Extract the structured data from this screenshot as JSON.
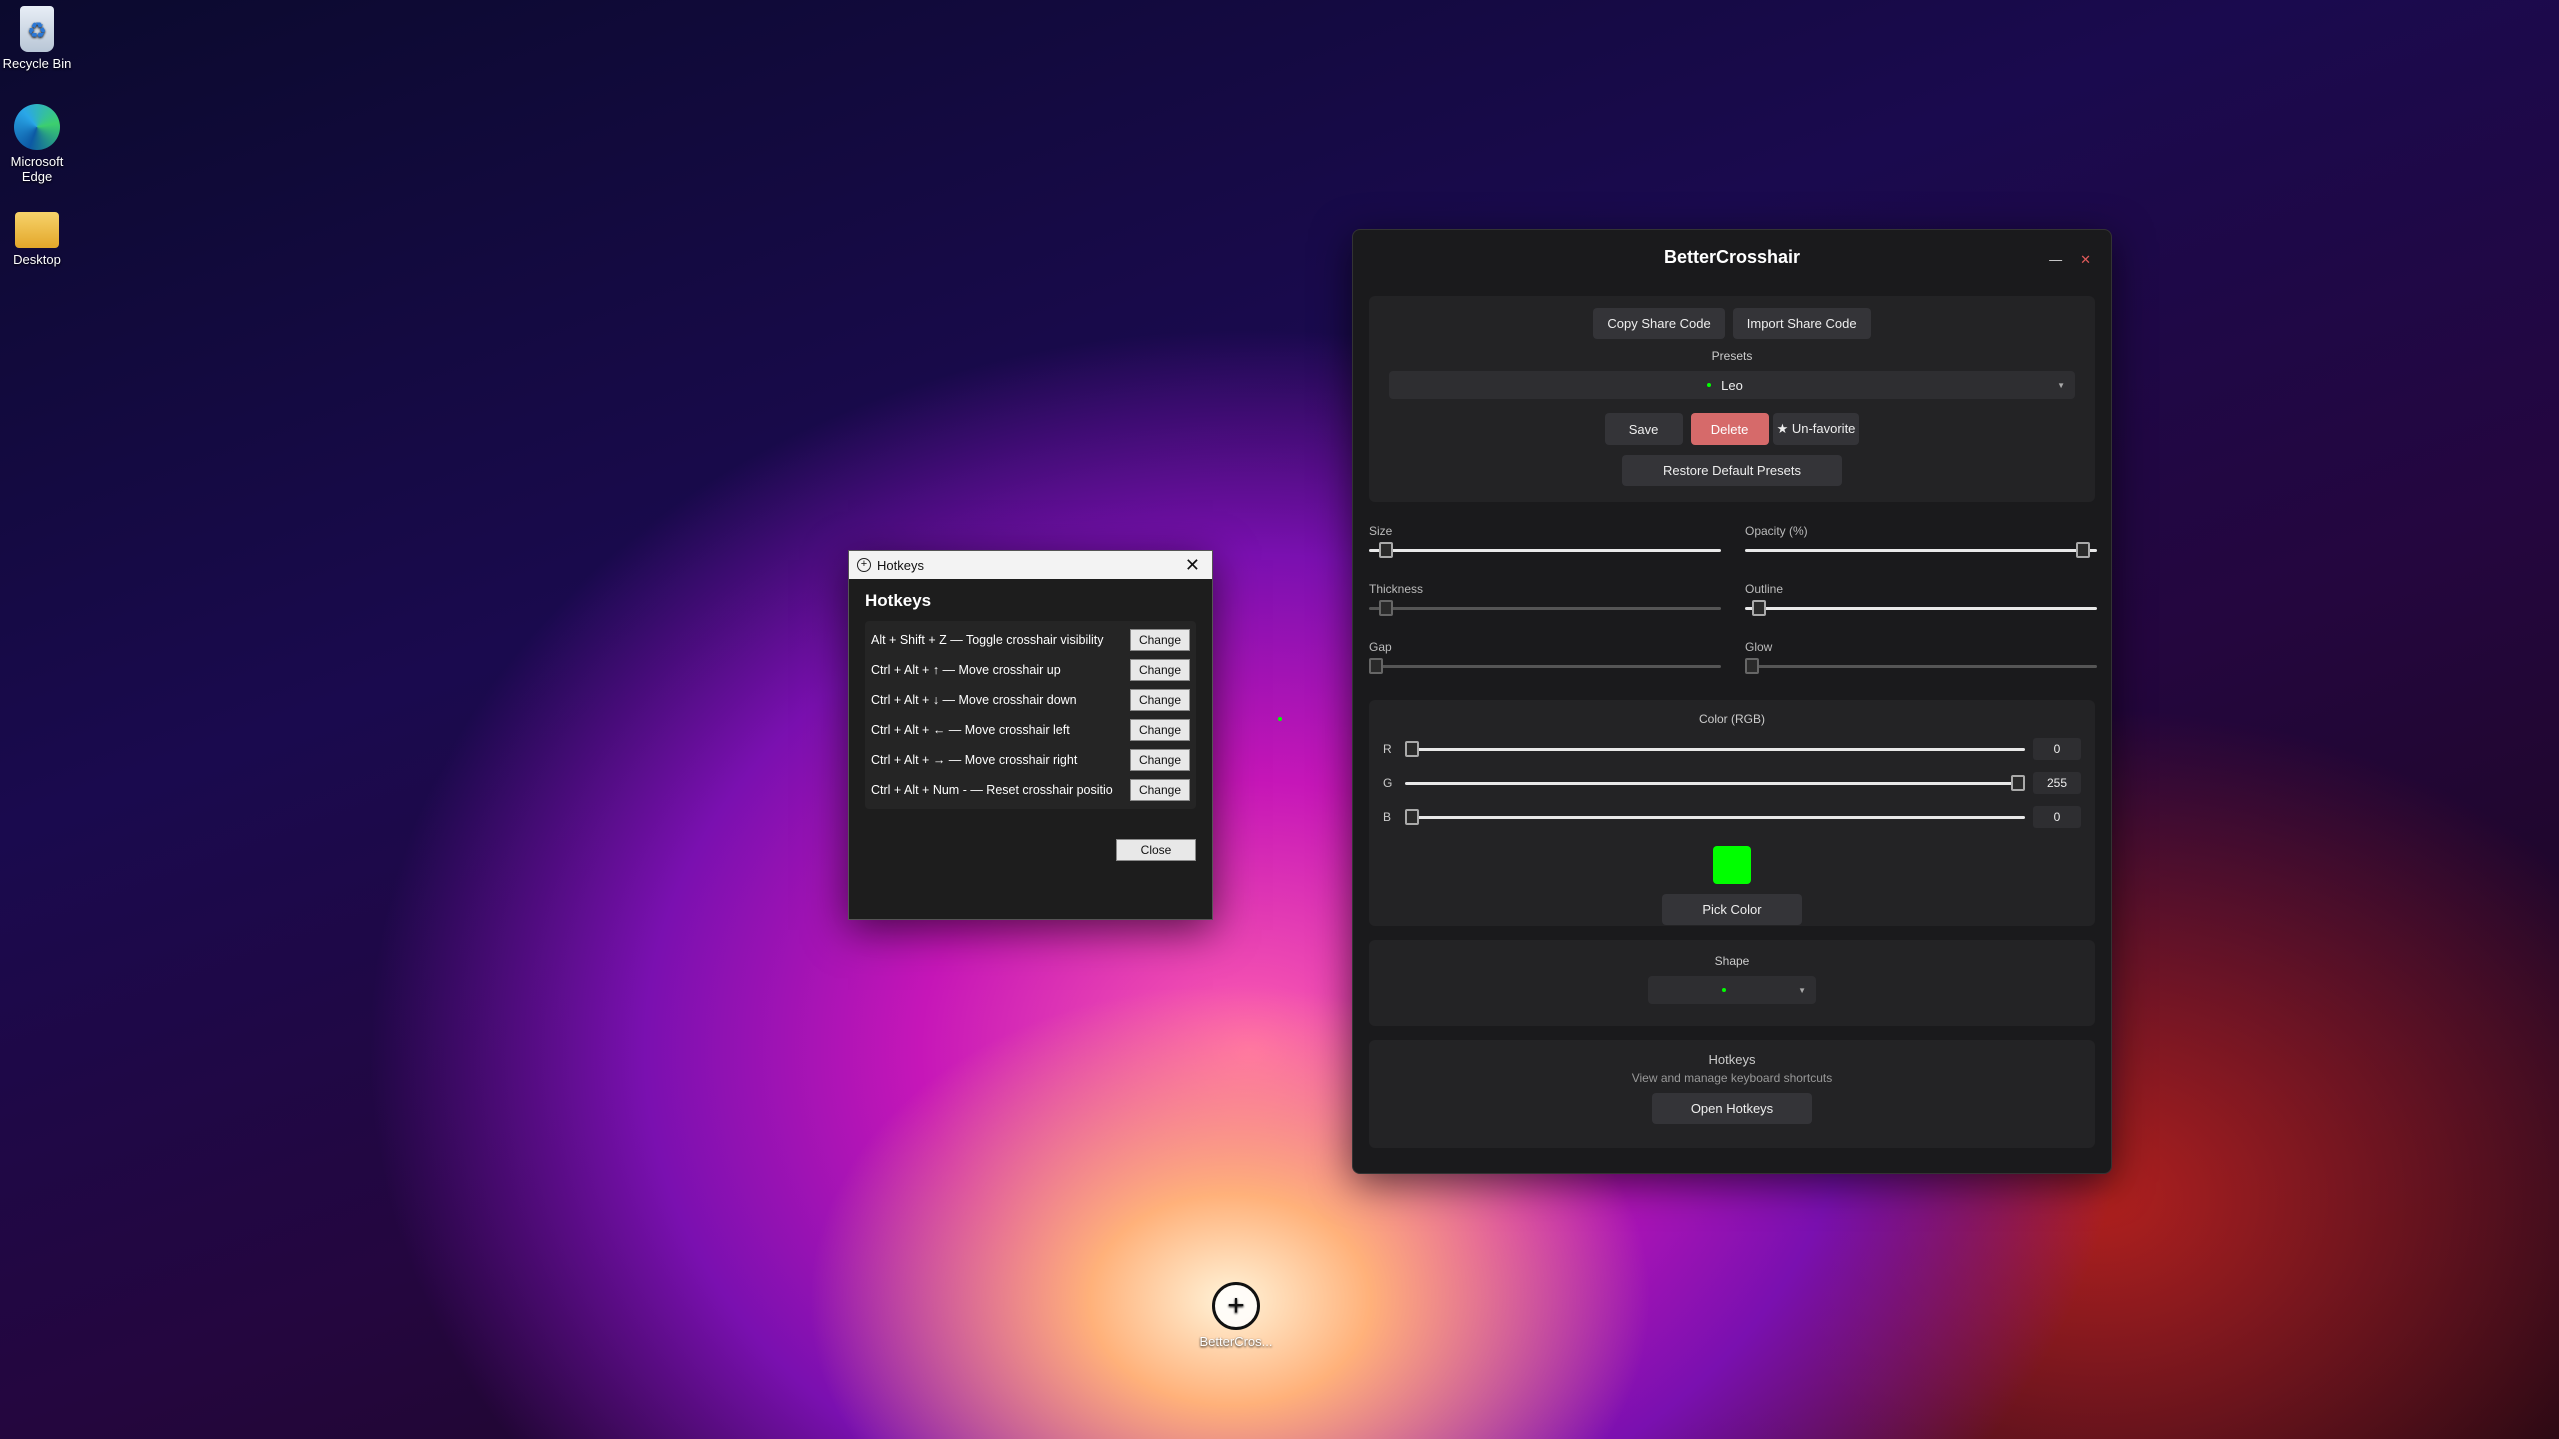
{
  "desktop": {
    "icons": [
      {
        "label": "Recycle Bin"
      },
      {
        "label": "Microsoft Edge"
      },
      {
        "label": "Desktop"
      }
    ],
    "shortcut_label": "BetterCros..."
  },
  "hotkeys_dialog": {
    "window_title": "Hotkeys",
    "heading": "Hotkeys",
    "rows": [
      {
        "text": "Alt + Shift + Z — Toggle crosshair visibility",
        "button": "Change"
      },
      {
        "text": "Ctrl + Alt + ↑ — Move crosshair up",
        "button": "Change"
      },
      {
        "text": "Ctrl + Alt + ↓ — Move crosshair down",
        "button": "Change"
      },
      {
        "text": "Ctrl + Alt + ← — Move crosshair left",
        "button": "Change"
      },
      {
        "text": "Ctrl + Alt + → — Move crosshair right",
        "button": "Change"
      },
      {
        "text": "Ctrl + Alt + Num - — Reset crosshair positior",
        "button": "Change"
      }
    ],
    "close_label": "Close"
  },
  "main": {
    "title": "BetterCrosshair",
    "minimize": "—",
    "close": "✕",
    "copy_share": "Copy Share Code",
    "import_share": "Import Share Code",
    "presets_label": "Presets",
    "preset_selected": "Leo",
    "save": "Save",
    "delete": "Delete",
    "unfavorite": "★ Un-favorite",
    "restore": "Restore Default Presets",
    "sliders": {
      "size": {
        "label": "Size",
        "value": 0.03
      },
      "opacity": {
        "label": "Opacity (%)",
        "value": 0.98
      },
      "thickness": {
        "label": "Thickness",
        "value": 0.03
      },
      "outline": {
        "label": "Outline",
        "value": 0.02
      },
      "gap": {
        "label": "Gap",
        "value": 0.0
      },
      "glow": {
        "label": "Glow",
        "value": 0.0
      }
    },
    "color_label": "Color (RGB)",
    "rgb": [
      {
        "ch": "R",
        "value": "0",
        "fraction": 0.0
      },
      {
        "ch": "G",
        "value": "255",
        "fraction": 1.0
      },
      {
        "ch": "B",
        "value": "0",
        "fraction": 0.0
      }
    ],
    "swatch_color": "#00ff00",
    "pick_color": "Pick Color",
    "shape_label": "Shape",
    "hotkeys_title": "Hotkeys",
    "hotkeys_sub": "View and manage keyboard shortcuts",
    "open_hotkeys": "Open Hotkeys"
  }
}
